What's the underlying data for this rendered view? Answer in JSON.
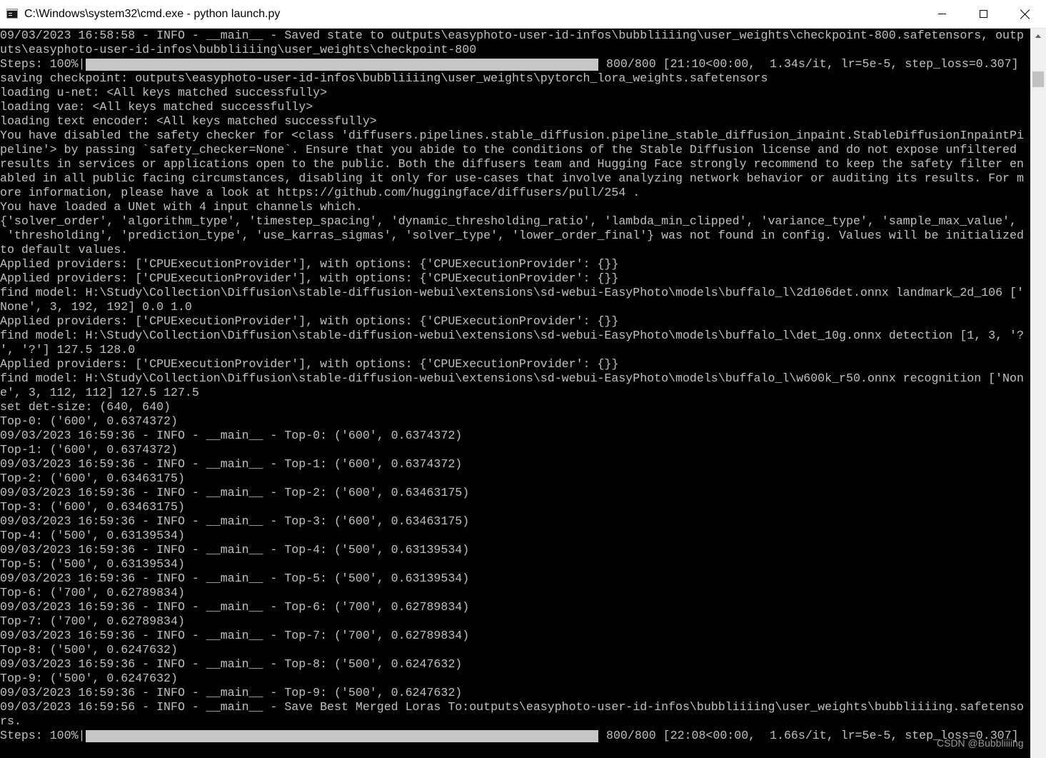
{
  "window": {
    "title": "C:\\Windows\\system32\\cmd.exe - python  launch.py",
    "icons": {
      "app": "console-icon",
      "minimize": "minimize-icon",
      "maximize": "maximize-icon",
      "close": "close-icon"
    }
  },
  "console": {
    "lines": [
      "09/03/2023 16:58:58 - INFO - __main__ - Saved state to outputs\\easyphoto-user-id-infos\\bubbliiiing\\user_weights\\checkpoint-800.safetensors, outp",
      "uts\\easyphoto-user-id-infos\\bubbliiiing\\user_weights\\checkpoint-800",
      "",
      "saving checkpoint: outputs\\easyphoto-user-id-infos\\bubbliiiing\\user_weights\\pytorch_lora_weights.safetensors",
      "loading u-net: <All keys matched successfully>",
      "loading vae: <All keys matched successfully>",
      "loading text encoder: <All keys matched successfully>",
      "You have disabled the safety checker for <class 'diffusers.pipelines.stable_diffusion.pipeline_stable_diffusion_inpaint.StableDiffusionInpaintPi",
      "peline'> by passing `safety_checker=None`. Ensure that you abide to the conditions of the Stable Diffusion license and do not expose unfiltered",
      "results in services or applications open to the public. Both the diffusers team and Hugging Face strongly recommend to keep the safety filter en",
      "abled in all public facing circumstances, disabling it only for use-cases that involve analyzing network behavior or auditing its results. For m",
      "ore information, please have a look at https://github.com/huggingface/diffusers/pull/254 .",
      "You have loaded a UNet with 4 input channels which.",
      "{'solver_order', 'algorithm_type', 'timestep_spacing', 'dynamic_thresholding_ratio', 'lambda_min_clipped', 'variance_type', 'sample_max_value',",
      " 'thresholding', 'prediction_type', 'use_karras_sigmas', 'solver_type', 'lower_order_final'} was not found in config. Values will be initialized",
      "to default values.",
      "Applied providers: ['CPUExecutionProvider'], with options: {'CPUExecutionProvider': {}}",
      "Applied providers: ['CPUExecutionProvider'], with options: {'CPUExecutionProvider': {}}",
      "find model: H:\\Study\\Collection\\Diffusion\\stable-diffusion-webui\\extensions\\sd-webui-EasyPhoto\\models\\buffalo_l\\2d106det.onnx landmark_2d_106 ['",
      "None', 3, 192, 192] 0.0 1.0",
      "Applied providers: ['CPUExecutionProvider'], with options: {'CPUExecutionProvider': {}}",
      "find model: H:\\Study\\Collection\\Diffusion\\stable-diffusion-webui\\extensions\\sd-webui-EasyPhoto\\models\\buffalo_l\\det_10g.onnx detection [1, 3, '?",
      "', '?'] 127.5 128.0",
      "Applied providers: ['CPUExecutionProvider'], with options: {'CPUExecutionProvider': {}}",
      "find model: H:\\Study\\Collection\\Diffusion\\stable-diffusion-webui\\extensions\\sd-webui-EasyPhoto\\models\\buffalo_l\\w600k_r50.onnx recognition ['Non",
      "e', 3, 112, 112] 127.5 127.5",
      "set det-size: (640, 640)",
      "Top-0: ('600', 0.6374372)",
      "09/03/2023 16:59:36 - INFO - __main__ - Top-0: ('600', 0.6374372)",
      "Top-1: ('600', 0.6374372)",
      "09/03/2023 16:59:36 - INFO - __main__ - Top-1: ('600', 0.6374372)",
      "Top-2: ('600', 0.63463175)",
      "09/03/2023 16:59:36 - INFO - __main__ - Top-2: ('600', 0.63463175)",
      "Top-3: ('600', 0.63463175)",
      "09/03/2023 16:59:36 - INFO - __main__ - Top-3: ('600', 0.63463175)",
      "Top-4: ('500', 0.63139534)",
      "09/03/2023 16:59:36 - INFO - __main__ - Top-4: ('500', 0.63139534)",
      "Top-5: ('500', 0.63139534)",
      "09/03/2023 16:59:36 - INFO - __main__ - Top-5: ('500', 0.63139534)",
      "Top-6: ('700', 0.62789834)",
      "09/03/2023 16:59:36 - INFO - __main__ - Top-6: ('700', 0.62789834)",
      "Top-7: ('700', 0.62789834)",
      "09/03/2023 16:59:36 - INFO - __main__ - Top-7: ('700', 0.62789834)",
      "Top-8: ('500', 0.6247632)",
      "09/03/2023 16:59:36 - INFO - __main__ - Top-8: ('500', 0.6247632)",
      "Top-9: ('500', 0.6247632)",
      "09/03/2023 16:59:36 - INFO - __main__ - Top-9: ('500', 0.6247632)",
      "09/03/2023 16:59:56 - INFO - __main__ - Save Best Merged Loras To:outputs\\easyphoto-user-id-infos\\bubbliiiing\\user_weights\\bubbliiiing.safetenso",
      "rs.",
      ""
    ],
    "progress": [
      {
        "label": "Steps: 100%|",
        "percent": 100,
        "stats": "800/800 [21:10<00:00,  1.34s/it, lr=5e-5, step_loss=0.307]"
      },
      {
        "label": "Steps: 100%|",
        "percent": 100,
        "stats": "800/800 [22:08<00:00,  1.66s/it, lr=5e-5, step_loss=0.307]"
      }
    ]
  },
  "watermark": "CSDN @Bubbliiiing",
  "colors": {
    "console_bg": "#000000",
    "console_text": "#c0c0c0",
    "titlebar_bg": "#ffffff",
    "scrollbar_bg": "#f0f0f0"
  }
}
